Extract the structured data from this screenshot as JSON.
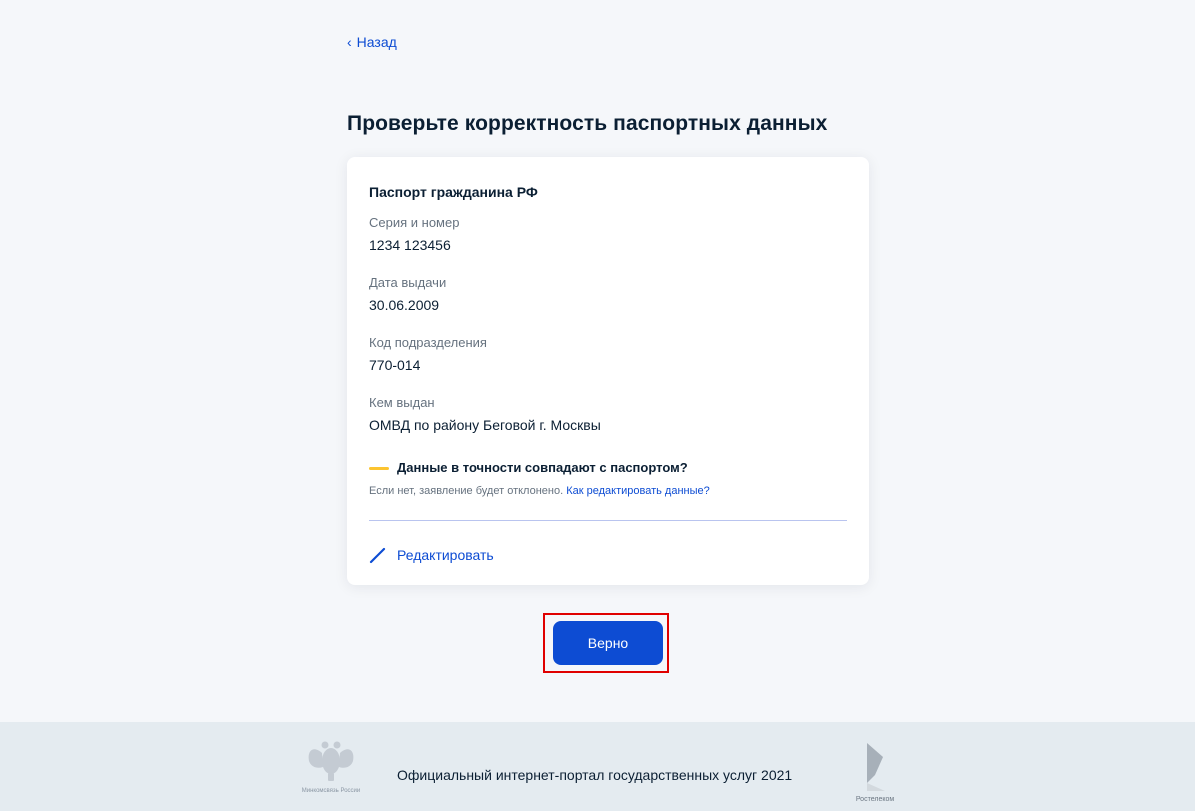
{
  "nav": {
    "back_label": "Назад"
  },
  "page": {
    "title": "Проверьте корректность паспортных данных"
  },
  "card": {
    "title": "Паспорт гражданина РФ",
    "fields": [
      {
        "label": "Серия и номер",
        "value": "1234 123456"
      },
      {
        "label": "Дата выдачи",
        "value": "30.06.2009"
      },
      {
        "label": "Код подразделения",
        "value": "770-014"
      },
      {
        "label": "Кем выдан",
        "value": "ОМВД по району Беговой г. Москвы"
      }
    ],
    "warning": {
      "title": "Данные в точности совпадают с паспортом?",
      "text": "Если нет, заявление будет отклонено.",
      "link": "Как редактировать данные?"
    },
    "edit_label": "Редактировать"
  },
  "actions": {
    "confirm_label": "Верно"
  },
  "footer": {
    "text": "Официальный интернет-портал государственных услуг 2021",
    "emblem_caption": "Минкомсвязь России",
    "partner_caption": "Ростелеком"
  },
  "colors": {
    "accent": "#0d4cd3",
    "warning": "#fcc430",
    "highlight": "#e00000",
    "background": "#f5f7fa",
    "footer_bg": "#e4ebf0"
  },
  "icons": {
    "back": "chevron-left-icon",
    "edit": "pencil-icon",
    "emblem": "coat-of-arms-icon",
    "partner_logo": "rostelecom-logo-icon"
  }
}
